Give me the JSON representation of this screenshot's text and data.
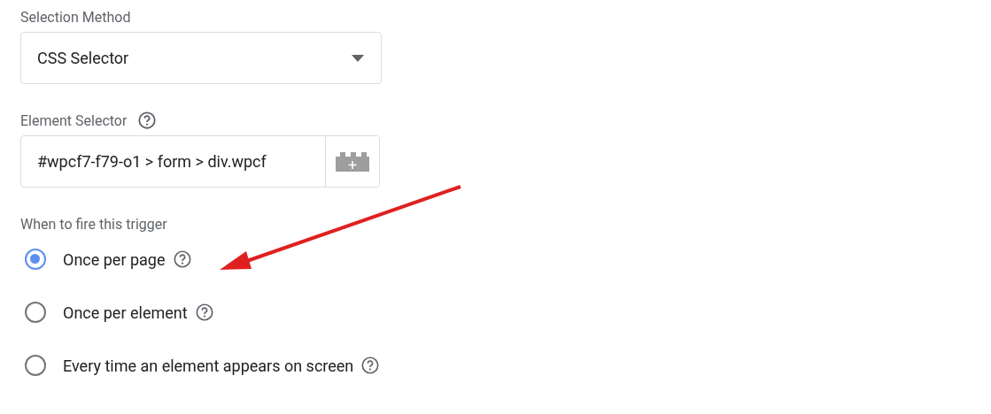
{
  "selection_method": {
    "label": "Selection Method",
    "value": "CSS Selector"
  },
  "element_selector": {
    "label": "Element Selector",
    "value": "#wpcf7-f79-o1 > form > div.wpcf"
  },
  "fire": {
    "label": "When to fire this trigger",
    "options": [
      {
        "label": "Once per page",
        "selected": true
      },
      {
        "label": "Once per element",
        "selected": false
      },
      {
        "label": "Every time an element appears on screen",
        "selected": false
      }
    ]
  }
}
